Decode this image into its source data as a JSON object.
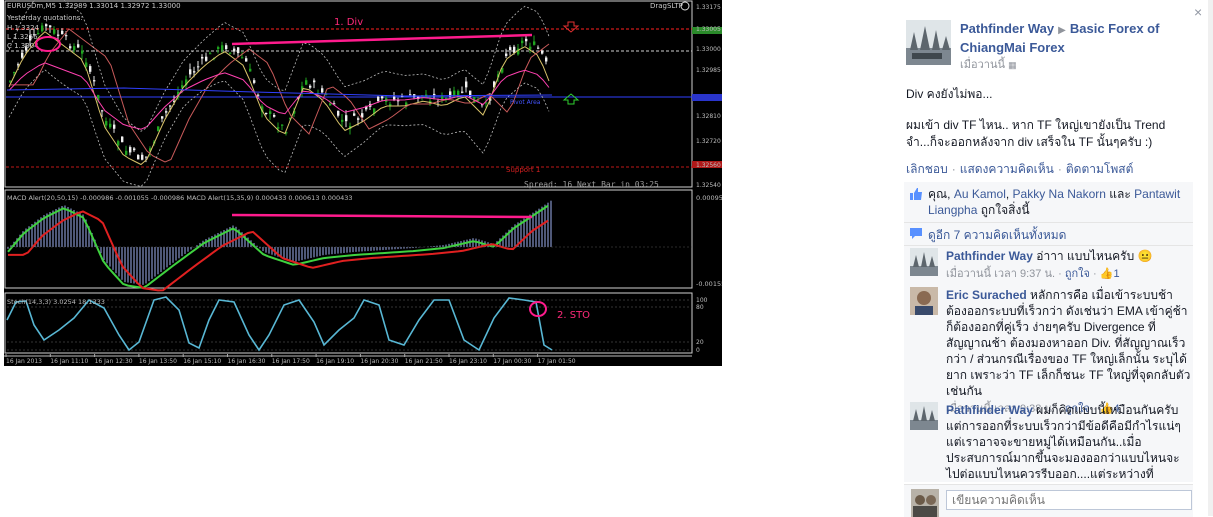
{
  "colors": {
    "link": "#3b5998",
    "meta": "#90949c",
    "panel_bg": "#f6f7f9",
    "chart_bg": "#000000",
    "pink": "#ff1b8d",
    "macd_hist": "#7a87b8",
    "macd_signal_green": "#3fd23f",
    "macd_red": "#e02020",
    "sto": "#58b7d4",
    "candle_up": "#1fa51f"
  },
  "chart": {
    "header": "EURUSDm,M5  1.32989 1.33014 1.32972 1.33000",
    "ea_name": "DragSLTP",
    "yesterday_label": "Yesterday quotations:",
    "yesterday_h": "H 1.3324",
    "yesterday_l": "L 1.3256",
    "yesterday_c": "C 1.3304",
    "prices": [
      "1.33175",
      "1.33005",
      "1.33000",
      "1.32985",
      "1.32810",
      "1.32720",
      "1.32560",
      "1.32540"
    ],
    "annotation_div": "1. Div",
    "annotation_sto": "2. STO",
    "support": "Support 1",
    "pivot": "Pivot Area",
    "spread": "Spread: 16  Next Bar in 03:25",
    "macd_title": "MACD Alert(20,50,15) -0.000986 -0.001055 -0.000986  MACD Alert(15,35,9) 0.000433 0.000613 0.000433",
    "macd_scale_top": "0.000959",
    "macd_scale_bottom": "-0.00155",
    "sto_title": "Stoch(14,3,3) 3.0254 18.1333",
    "sto_scale": [
      "100",
      "80",
      "20",
      "0"
    ],
    "time_labels": [
      "16 Jan 2013",
      "16 Jan 11:10",
      "16 Jan 12:30",
      "16 Jan 13:50",
      "16 Jan 15:10",
      "16 Jan 16:30",
      "16 Jan 17:50",
      "16 Jan 19:10",
      "16 Jan 20:30",
      "16 Jan 21:50",
      "16 Jan 23:10",
      "17 Jan 00:30",
      "17 Jan 01:50"
    ]
  },
  "post": {
    "author": "Pathfinder Way",
    "group": "Basic Forex of ChiangMai Forex",
    "time": "เมื่อวานนี้",
    "line1": "Div คงยังไม่พอ...",
    "line2": "ผมเข้า div TF ไหน.. หาก TF ใหญ่เขายังเป็น Trend จำ...ก็จะออกหลังจาก div เสร็จใน TF นั้นๆครับ :)",
    "actions": [
      "เลิกชอบ",
      "แสดงความคิดเห็น",
      "ติดตามโพสต์"
    ]
  },
  "likes": {
    "prefix": "คุณ,",
    "names": [
      "Au Kamol",
      "Pakky Na Nakorn"
    ],
    "and": "และ",
    "last": "Pantawit Liangpha",
    "suffix": "ถูกใจสิ่งนี้"
  },
  "view_more": "ดูอีก 7 ความคิดเห็นทั้งหมด",
  "comments": [
    {
      "name": "Pathfinder Way",
      "text": "อ่าาา แบบไหนครับ 😐",
      "time": "เมื่อวานนี้ เวลา 9:37 น.",
      "like": "ถูกใจ",
      "count": "1"
    },
    {
      "name": "Eric Surached",
      "text": "หลักการคือ เมื่อเข้าระบบช้า ต้องออกระบบที่เร็วกว่า ดังเช่นว่า EMA เข้าคู่ช้า ก็ต้องออกที่คู่เร็ว ง่ายๆครับ Divergence ที่สัญญาณช้า ต้องมองหาออก Div. ที่สัญญาณเร็วกว่า / ส่วนกรณีเรื่องของ TF ใหญ่เล็กนั้น ระบุได้ยาก เพราะว่า TF เล็กก็ชนะ TF ใหญ่ที่จุดกลับตัว เช่นกัน",
      "time": "เมื่อวานนี้ เวลา 9:38 น.",
      "like": "ถูกใจ",
      "count": "4"
    },
    {
      "name": "Pathfinder Way",
      "text": "ผมก็คิดแบบนี้เหมือนกันครับ แต่การออกที่ระบบเร็วกว่ามีข้อดีคือมีกำไรแน่ๆ แต่เราอาจจะขายหมู่ได้เหมือนกัน..เมื่อประสบการณ์มากขึ้นจะมองออกว่าแบบไหนจะไปต่อแบบไหนควรรีบออก....แต่ระหว่างที่ประสบการณ์ยังไม่พอ... ทางสายกลางคือแบ่งออกครึ่งหนึ่ง ไปต่อครึ่งหนึ่ง",
      "time": "",
      "like": "",
      "count": ""
    }
  ],
  "write_placeholder": "เขียนความคิดเห็น",
  "close_label": "×"
}
